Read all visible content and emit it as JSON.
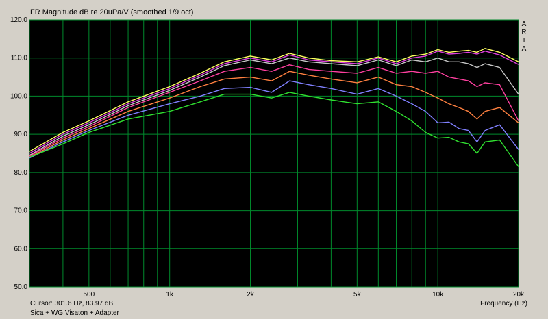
{
  "title": "FR Magnitude dB re 20uPa/V (smoothed 1/9 oct)",
  "brand_letters": [
    "A",
    "R",
    "T",
    "A"
  ],
  "cursor_readout": "Cursor: 301.6 Hz, 83.97 dB",
  "caption": "Sica + WG Visaton + Adapter",
  "colors": {
    "panel": "#d4d0c8",
    "plot_background": "#000000",
    "grid": "#008a2c"
  },
  "chart_data": {
    "type": "line",
    "title": "FR Magnitude dB re 20uPa/V (smoothed 1/9 oct)",
    "xlabel": "Frequency (Hz)",
    "ylabel": "",
    "x_scale": "log",
    "xlim": [
      300,
      20000
    ],
    "ylim": [
      50,
      120
    ],
    "grid": true,
    "y_ticks": [
      {
        "value": 120,
        "label": "120.0"
      },
      {
        "value": 110,
        "label": "110.0"
      },
      {
        "value": 100,
        "label": "100.0"
      },
      {
        "value": 90,
        "label": "90.0"
      },
      {
        "value": 80,
        "label": "80.0"
      },
      {
        "value": 70,
        "label": "70.0"
      },
      {
        "value": 60,
        "label": "60.0"
      },
      {
        "value": 50,
        "label": "50.0"
      }
    ],
    "x_ticks": [
      {
        "value": 500,
        "label": "500"
      },
      {
        "value": 1000,
        "label": "1k"
      },
      {
        "value": 2000,
        "label": "2k"
      },
      {
        "value": 5000,
        "label": "5k"
      },
      {
        "value": 10000,
        "label": "10k"
      },
      {
        "value": 20000,
        "label": "20k"
      }
    ],
    "x_minor_gridlines": [
      300,
      400,
      500,
      600,
      700,
      800,
      900,
      1000,
      2000,
      3000,
      4000,
      5000,
      6000,
      7000,
      8000,
      9000,
      10000,
      20000
    ],
    "series": [
      {
        "color": "#ffff60",
        "x": [
          300,
          400,
          500,
          700,
          1000,
          1300,
          1600,
          2000,
          2400,
          2800,
          3300,
          4000,
          5000,
          6000,
          7000,
          8000,
          9000,
          10000,
          11000,
          12000,
          13000,
          14000,
          15000,
          17000,
          20000
        ],
        "y": [
          85.5,
          90.5,
          93.5,
          98.5,
          102.5,
          106,
          109,
          110.5,
          109.5,
          111.2,
          110,
          109.3,
          109,
          110.3,
          109,
          110.5,
          111,
          112.2,
          111.5,
          111.8,
          112,
          111.5,
          112.5,
          111.5,
          109
        ]
      },
      {
        "color": "#e040e0",
        "x": [
          300,
          400,
          500,
          700,
          1000,
          1300,
          1600,
          2000,
          2400,
          2800,
          3300,
          4000,
          5000,
          6000,
          7000,
          8000,
          9000,
          10000,
          11000,
          12000,
          13000,
          14000,
          15000,
          17000,
          20000
        ],
        "y": [
          85,
          90,
          93,
          98,
          102,
          105.5,
          108.5,
          110,
          109,
          110.8,
          109.5,
          109,
          108.5,
          110,
          108.5,
          110,
          110.5,
          111.8,
          111,
          111.2,
          111.5,
          111,
          111.8,
          110.8,
          108.3
        ]
      },
      {
        "color": "#c8c8c8",
        "x": [
          300,
          400,
          500,
          700,
          1000,
          1300,
          1600,
          2000,
          2400,
          2800,
          3300,
          4000,
          5000,
          6000,
          7000,
          8000,
          9000,
          10000,
          11000,
          12000,
          13000,
          14000,
          15000,
          17000,
          20000
        ],
        "y": [
          84.5,
          89.5,
          92.5,
          97.5,
          101.5,
          105,
          108,
          109.5,
          108.5,
          110,
          109,
          108.5,
          108,
          109.5,
          108,
          109.5,
          109,
          110,
          109,
          109,
          108.5,
          107.5,
          108.5,
          107.5,
          100.5
        ]
      },
      {
        "color": "#ff40a0",
        "x": [
          300,
          400,
          500,
          700,
          1000,
          1300,
          1600,
          2000,
          2400,
          2800,
          3300,
          4000,
          5000,
          6000,
          7000,
          8000,
          9000,
          10000,
          11000,
          12000,
          13000,
          14000,
          15000,
          17000,
          20000
        ],
        "y": [
          84.3,
          89,
          92,
          97,
          101,
          104,
          106.5,
          107.5,
          106.5,
          108.2,
          107,
          106.5,
          106,
          107.5,
          106,
          106.5,
          106,
          106.5,
          105,
          104.5,
          104,
          102.5,
          103.5,
          103,
          93.5
        ]
      },
      {
        "color": "#ff8040",
        "x": [
          300,
          400,
          500,
          700,
          1000,
          1300,
          1600,
          2000,
          2400,
          2800,
          3300,
          4000,
          5000,
          6000,
          7000,
          8000,
          9000,
          10000,
          11000,
          12000,
          13000,
          14000,
          15000,
          17000,
          20000
        ],
        "y": [
          84,
          88.5,
          91.5,
          96,
          99.5,
          102.5,
          104.5,
          105,
          104,
          106.5,
          105.5,
          104.5,
          103.5,
          105,
          103,
          102.5,
          101,
          99.5,
          98,
          97,
          96,
          94,
          96,
          97,
          93
        ]
      },
      {
        "color": "#8080ff",
        "x": [
          300,
          400,
          500,
          700,
          1000,
          1300,
          1600,
          2000,
          2400,
          2800,
          3300,
          4000,
          5000,
          6000,
          7000,
          8000,
          9000,
          10000,
          11000,
          12000,
          13000,
          14000,
          15000,
          17000,
          20000
        ],
        "y": [
          83.8,
          88,
          91,
          95,
          98,
          100,
          102,
          102.3,
          101,
          104,
          103,
          102,
          100.5,
          102,
          100,
          98,
          96,
          93,
          93.2,
          91.5,
          91,
          88,
          91,
          92.5,
          86
        ]
      },
      {
        "color": "#30e030",
        "x": [
          300,
          400,
          500,
          700,
          1000,
          1300,
          1600,
          2000,
          2400,
          2800,
          3300,
          4000,
          5000,
          6000,
          7000,
          8000,
          9000,
          10000,
          11000,
          12000,
          13000,
          14000,
          15000,
          17000,
          20000
        ],
        "y": [
          83.97,
          87.5,
          90.5,
          94,
          96,
          98.5,
          100.5,
          100.5,
          99.5,
          101,
          100,
          99,
          98,
          98.5,
          96,
          93.5,
          90.5,
          89,
          89.2,
          88,
          87.5,
          85,
          88,
          88.5,
          81.5
        ]
      }
    ]
  }
}
